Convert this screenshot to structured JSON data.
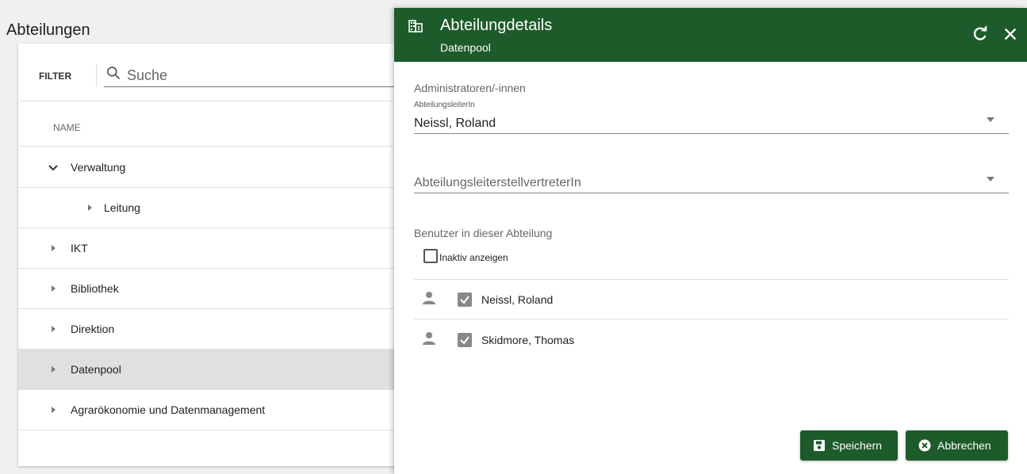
{
  "left_panel": {
    "title": "Abteilungen",
    "filter_label": "FILTER",
    "search": {
      "placeholder": "Suche",
      "icon": "search-icon"
    },
    "column_header": "NAME",
    "tree": [
      {
        "label": "Verwaltung",
        "expanded": true,
        "level": 0
      },
      {
        "label": "Leitung",
        "expanded": false,
        "level": 1
      },
      {
        "label": "IKT",
        "expanded": false,
        "level": 0
      },
      {
        "label": "Bibliothek",
        "expanded": false,
        "level": 0
      },
      {
        "label": "Direktion",
        "expanded": false,
        "level": 0
      },
      {
        "label": "Datenpool",
        "expanded": false,
        "level": 0,
        "selected": true
      },
      {
        "label": "Agrarökonomie und Datenmanagement",
        "expanded": false,
        "level": 0
      }
    ]
  },
  "drawer": {
    "header": {
      "title": "Abteilungdetails",
      "subtitle": "Datenpool",
      "icon": "building-icon",
      "header_color": "#1e5b2a"
    },
    "admins": {
      "section_title": "Administratoren/-innen",
      "leader_label": "AbteilungsleiterIn",
      "leader_value": "Neissl, Roland",
      "deputy_placeholder": "AbteilungsleiterstellvertreterIn"
    },
    "users": {
      "section_title": "Benutzer in dieser Abteilung",
      "show_inactive_label": "Inaktiv anzeigen",
      "show_inactive_checked": false,
      "list": [
        {
          "name": "Neissl, Roland",
          "checked": true
        },
        {
          "name": "Skidmore, Thomas",
          "checked": true
        }
      ]
    },
    "actions": {
      "save_label": "Speichern",
      "cancel_label": "Abbrechen"
    }
  }
}
